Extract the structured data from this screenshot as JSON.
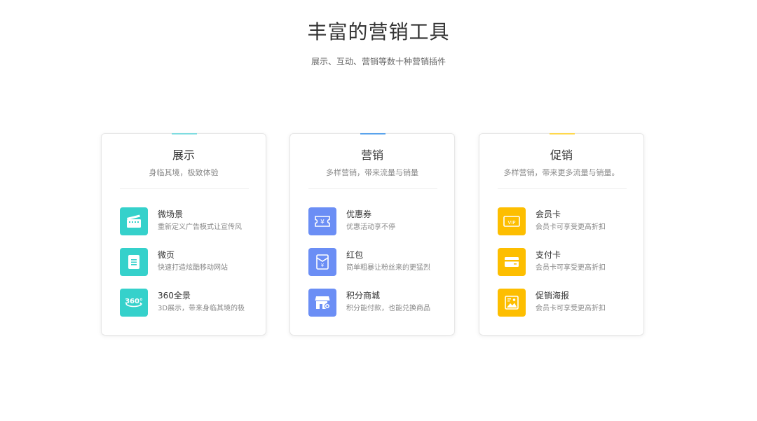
{
  "header": {
    "title": "丰富的营销工具",
    "subtitle": "展示、互动、营销等数十种营销插件"
  },
  "colors": {
    "teal": "#35d1cb",
    "blue": "#6b8ef5",
    "yellow": "#fdbe00",
    "accent_teal": "#7fdce0",
    "accent_blue": "#5aa3ec",
    "accent_yellow": "#ffd84c"
  },
  "cards": [
    {
      "title": "展示",
      "subtitle": "身临其境，极致体验",
      "items": [
        {
          "name": "微场景",
          "desc": "重新定义广告模式让宣传风",
          "icon": "clapperboard-icon"
        },
        {
          "name": "微页",
          "desc": "快速打造炫酷移动网站",
          "icon": "document-icon"
        },
        {
          "name": "360全景",
          "desc": "3D展示，带来身临其境的极",
          "icon": "panorama-360-icon"
        }
      ]
    },
    {
      "title": "营销",
      "subtitle": "多样营销，带来流量与销量",
      "items": [
        {
          "name": "优惠券",
          "desc": "优惠活动享不停",
          "icon": "coupon-icon"
        },
        {
          "name": "红包",
          "desc": "简单粗暴让粉丝来的更猛烈",
          "icon": "red-envelope-icon"
        },
        {
          "name": "积分商城",
          "desc": "积分能付款，也能兑换商品",
          "icon": "store-icon"
        }
      ]
    },
    {
      "title": "促销",
      "subtitle": "多样营销，带来更多流量与销量。",
      "items": [
        {
          "name": "会员卡",
          "desc": "会员卡可享受更高折扣",
          "icon": "vip-card-icon"
        },
        {
          "name": "支付卡",
          "desc": "会员卡可享受更高折扣",
          "icon": "payment-card-icon"
        },
        {
          "name": "促销海报",
          "desc": "会员卡可享受更高折扣",
          "icon": "poster-icon"
        }
      ]
    }
  ]
}
